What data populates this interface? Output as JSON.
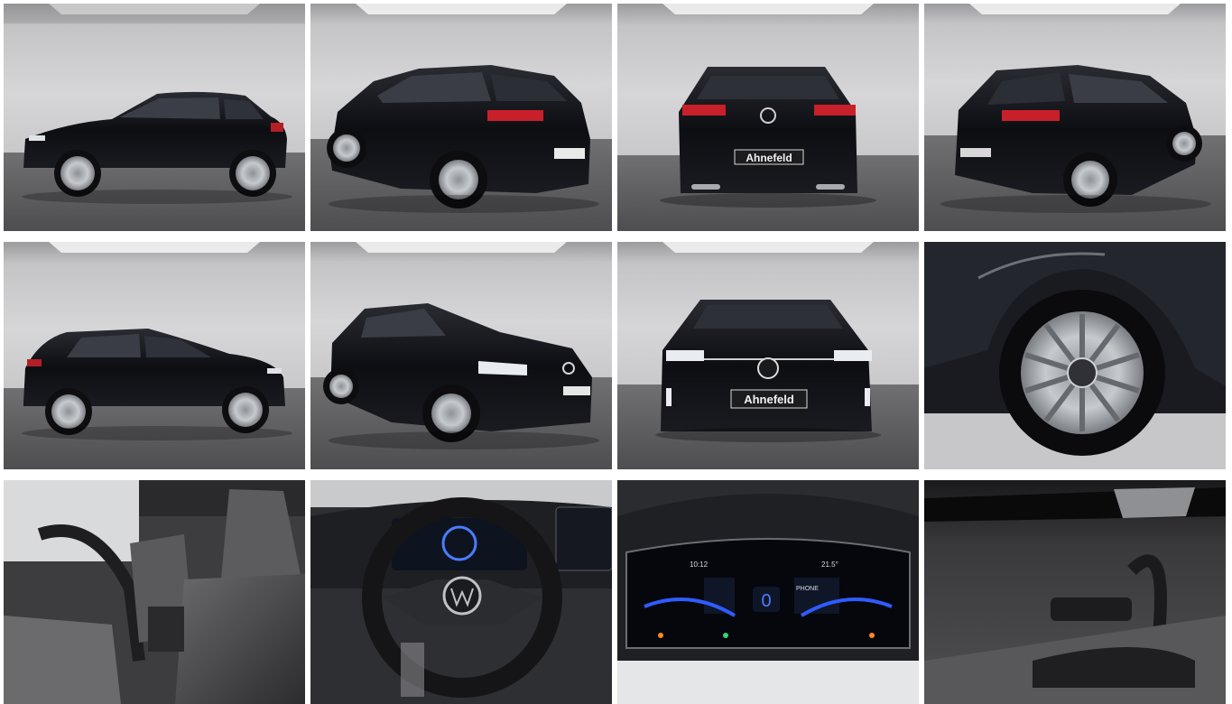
{
  "gallery": {
    "photos": [
      {
        "id": "side-left"
      },
      {
        "id": "rear-three-quarter-left"
      },
      {
        "id": "rear"
      },
      {
        "id": "rear-three-quarter-right",
        "plate": ""
      },
      {
        "id": "side-right"
      },
      {
        "id": "front-three-quarter-left"
      },
      {
        "id": "front",
        "plate": "Ahnefeld"
      },
      {
        "id": "wheel"
      },
      {
        "id": "front-seats"
      },
      {
        "id": "steering-wheel"
      },
      {
        "id": "instrument-cluster"
      },
      {
        "id": "door-panel"
      }
    ],
    "rear_plate": "Ahnefeld",
    "cluster": {
      "time": "10:12",
      "gear": "0",
      "temp": "21.5°",
      "media": "PHONE"
    }
  },
  "colors": {
    "studio_wall": "#c9c9cc",
    "studio_floor": "#5f5f62",
    "car_body": "#111216",
    "wheel_silver": "#b9bcc0",
    "tail_light": "#c8202a",
    "cluster_blue": "#2f5bff"
  }
}
